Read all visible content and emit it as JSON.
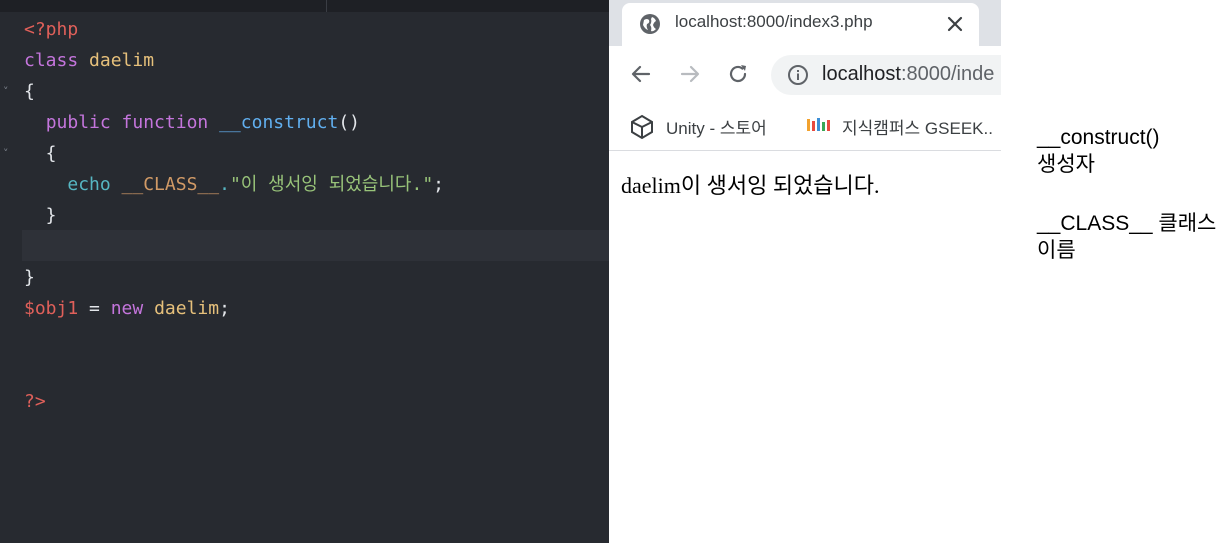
{
  "editor": {
    "lines": [
      [
        {
          "t": "<?php",
          "c": "t-tag"
        }
      ],
      [
        {
          "t": "class ",
          "c": "t-kw"
        },
        {
          "t": "daelim",
          "c": "t-cls"
        }
      ],
      [
        {
          "t": "{",
          "c": "t-plain"
        }
      ],
      [
        {
          "t": "  ",
          "c": "t-plain"
        },
        {
          "t": "public ",
          "c": "t-kw"
        },
        {
          "t": "function ",
          "c": "t-kw"
        },
        {
          "t": "__construct",
          "c": "t-fn"
        },
        {
          "t": "()",
          "c": "t-plain"
        }
      ],
      [
        {
          "t": "  {",
          "c": "t-plain"
        }
      ],
      [
        {
          "t": "    ",
          "c": "t-plain"
        },
        {
          "t": "echo ",
          "c": "t-cyan"
        },
        {
          "t": "__CLASS__",
          "c": "t-const"
        },
        {
          "t": ".",
          "c": "t-cyan"
        },
        {
          "t": "\"이 생서잉 되었습니다.\"",
          "c": "t-str"
        },
        {
          "t": ";",
          "c": "t-plain"
        }
      ],
      [
        {
          "t": "  }",
          "c": "t-plain"
        }
      ],
      [],
      [
        {
          "t": "}",
          "c": "t-plain"
        }
      ],
      [
        {
          "t": "$obj1",
          "c": "t-var"
        },
        {
          "t": " = ",
          "c": "t-plain"
        },
        {
          "t": "new ",
          "c": "t-kw"
        },
        {
          "t": "daelim",
          "c": "t-cls"
        },
        {
          "t": ";",
          "c": "t-plain"
        }
      ],
      [],
      [],
      [
        {
          "t": "?>",
          "c": "t-tag"
        }
      ]
    ],
    "fold_markers": [
      "˅",
      "˅"
    ],
    "colors": {
      "background": "#272a30",
      "current_line": "#2e3138",
      "keyword": "#c475dc",
      "class": "#e6c07b",
      "function": "#61afef",
      "string": "#98c379",
      "tag": "#e0605a"
    }
  },
  "browser": {
    "tab": {
      "title": "localhost:8000/index3.php",
      "icon": "globe-icon",
      "close_icon": "close-icon"
    },
    "toolbar": {
      "back_icon": "back-arrow-icon",
      "forward_icon": "forward-arrow-icon",
      "reload_icon": "reload-icon"
    },
    "omnibox": {
      "host": "localhost",
      "rest": ":8000/inde",
      "icon": "info-icon"
    },
    "bookmarks": [
      {
        "label": "Unity - 스토어",
        "icon": "unity-logo-icon"
      },
      {
        "label": "지식캠퍼스 GSEEK..",
        "icon": "gseek-logo-icon"
      }
    ],
    "page": {
      "output": "daelim이 생서잉 되었습니다."
    }
  },
  "notes": {
    "construct": "__construct()\n생성자",
    "class_name": "__CLASS__ 클래스 이름"
  }
}
